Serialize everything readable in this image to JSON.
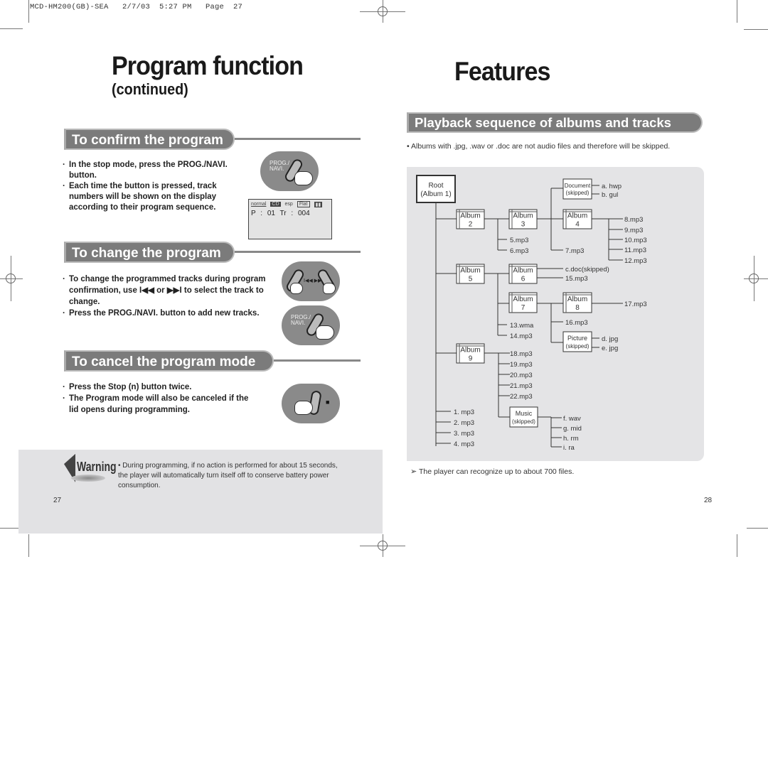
{
  "slug": "MCD-HM200(GB)-SEA   2/7/03  5:27 PM   Page  27",
  "left_page": {
    "title": "Program function",
    "subtitle": "(continued)",
    "sections": [
      {
        "heading": "To confirm the program",
        "bullets": [
          "In the stop mode, press the PROG./NAVI. button.",
          "Each time the button is pressed, track numbers will be shown on the display according to their program sequence."
        ],
        "button_label": "PROG./ NAVI."
      },
      {
        "heading": "To change the program",
        "bullets": [
          "To change the programmed tracks during program confirmation, use I◀◀ or ▶▶I to select the track to change.",
          "Press the PROG./NAVI. button to add new tracks."
        ],
        "skip_button_label": "I◀◀ ▶▶I",
        "button_label": "PROG./ NAVI."
      },
      {
        "heading": "To cancel the program mode",
        "bullets": [
          "Press the Stop (n) button twice.",
          "The Program mode will also be canceled if the lid opens during programming."
        ],
        "stop_symbol": "■"
      }
    ],
    "display": {
      "mode": "normal",
      "esp": "esp",
      "eq": "Flat",
      "line": "P : 01   Tr : 004"
    },
    "warning": {
      "label": "Warning",
      "text": "• During programming, if no action is performed for about 15 seconds, the player will automatically turn itself off to conserve battery power consumption."
    },
    "page_number": "27"
  },
  "right_page": {
    "title": "Features",
    "section_heading": "Playback sequence of albums and tracks",
    "note": "• Albums with .jpg, .wav or .doc are not audio files and therefore will be skipped.",
    "footnote": "The player can recognize up to about 700 files.",
    "page_number": "28",
    "tree": {
      "root": [
        "Root",
        "(Album 1)"
      ],
      "albums": [
        {
          "id": "a2",
          "lines": [
            "Album",
            "2"
          ]
        },
        {
          "id": "a3",
          "lines": [
            "Album",
            "3"
          ]
        },
        {
          "id": "a4",
          "lines": [
            "Album",
            "4"
          ]
        },
        {
          "id": "a5",
          "lines": [
            "Album",
            "5"
          ]
        },
        {
          "id": "a6",
          "lines": [
            "Album",
            "6"
          ]
        },
        {
          "id": "a7",
          "lines": [
            "Album",
            "7"
          ]
        },
        {
          "id": "a8",
          "lines": [
            "Album",
            "8"
          ]
        },
        {
          "id": "a9",
          "lines": [
            "Album",
            "9"
          ]
        }
      ],
      "skipped_folders": [
        {
          "id": "doc",
          "lines": [
            "Document",
            "(skipped)"
          ],
          "files": [
            "a. hwp",
            "b. gul"
          ]
        },
        {
          "id": "pic",
          "lines": [
            "Picture",
            "(skipped)"
          ],
          "files": [
            "d. jpg",
            "e. jpg"
          ]
        },
        {
          "id": "mus",
          "lines": [
            "Music",
            "(skipped)"
          ],
          "files": [
            "f. wav",
            "g. mid",
            "h. rm",
            "i. ra"
          ]
        }
      ],
      "files": {
        "root": [
          "1. mp3",
          "2. mp3",
          "3. mp3",
          "4. mp3"
        ],
        "a2": [
          "5.mp3",
          "6.mp3"
        ],
        "a3": [
          "7.mp3"
        ],
        "a4": [
          "8.mp3",
          "9.mp3",
          "10.mp3",
          "11.mp3",
          "12.mp3"
        ],
        "a5": [
          "13.wma",
          "14.mp3"
        ],
        "a6": [
          "c.doc(skipped)",
          "15.mp3"
        ],
        "a7": [
          "16.mp3"
        ],
        "a8": [
          "17.mp3"
        ],
        "a9": [
          "18.mp3",
          "19.mp3",
          "20.mp3",
          "21.mp3",
          "22.mp3"
        ]
      }
    }
  }
}
